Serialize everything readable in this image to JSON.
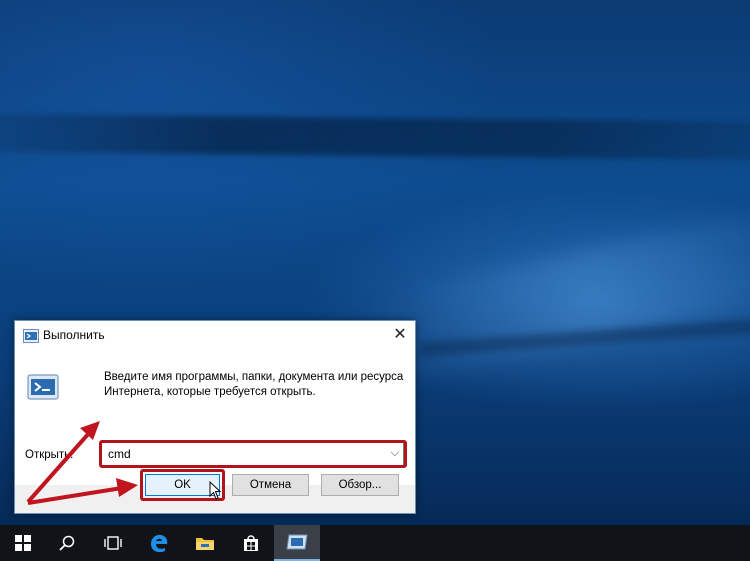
{
  "dialog": {
    "title": "Выполнить",
    "close_label": "✕",
    "description": "Введите имя программы, папки, документа или ресурса Интернета, которые требуется открыть.",
    "open_label": "Открыть:",
    "command_value": "cmd",
    "ok_label": "OK",
    "cancel_label": "Отмена",
    "browse_label": "Обзор..."
  },
  "taskbar": {
    "items": [
      "start-icon",
      "search-icon",
      "task-view-icon",
      "edge-icon",
      "file-explorer-icon",
      "store-icon",
      "run-icon"
    ]
  },
  "colors": {
    "highlight": "#b3131c",
    "taskbar": "#101418",
    "accent": "#0078d7"
  }
}
